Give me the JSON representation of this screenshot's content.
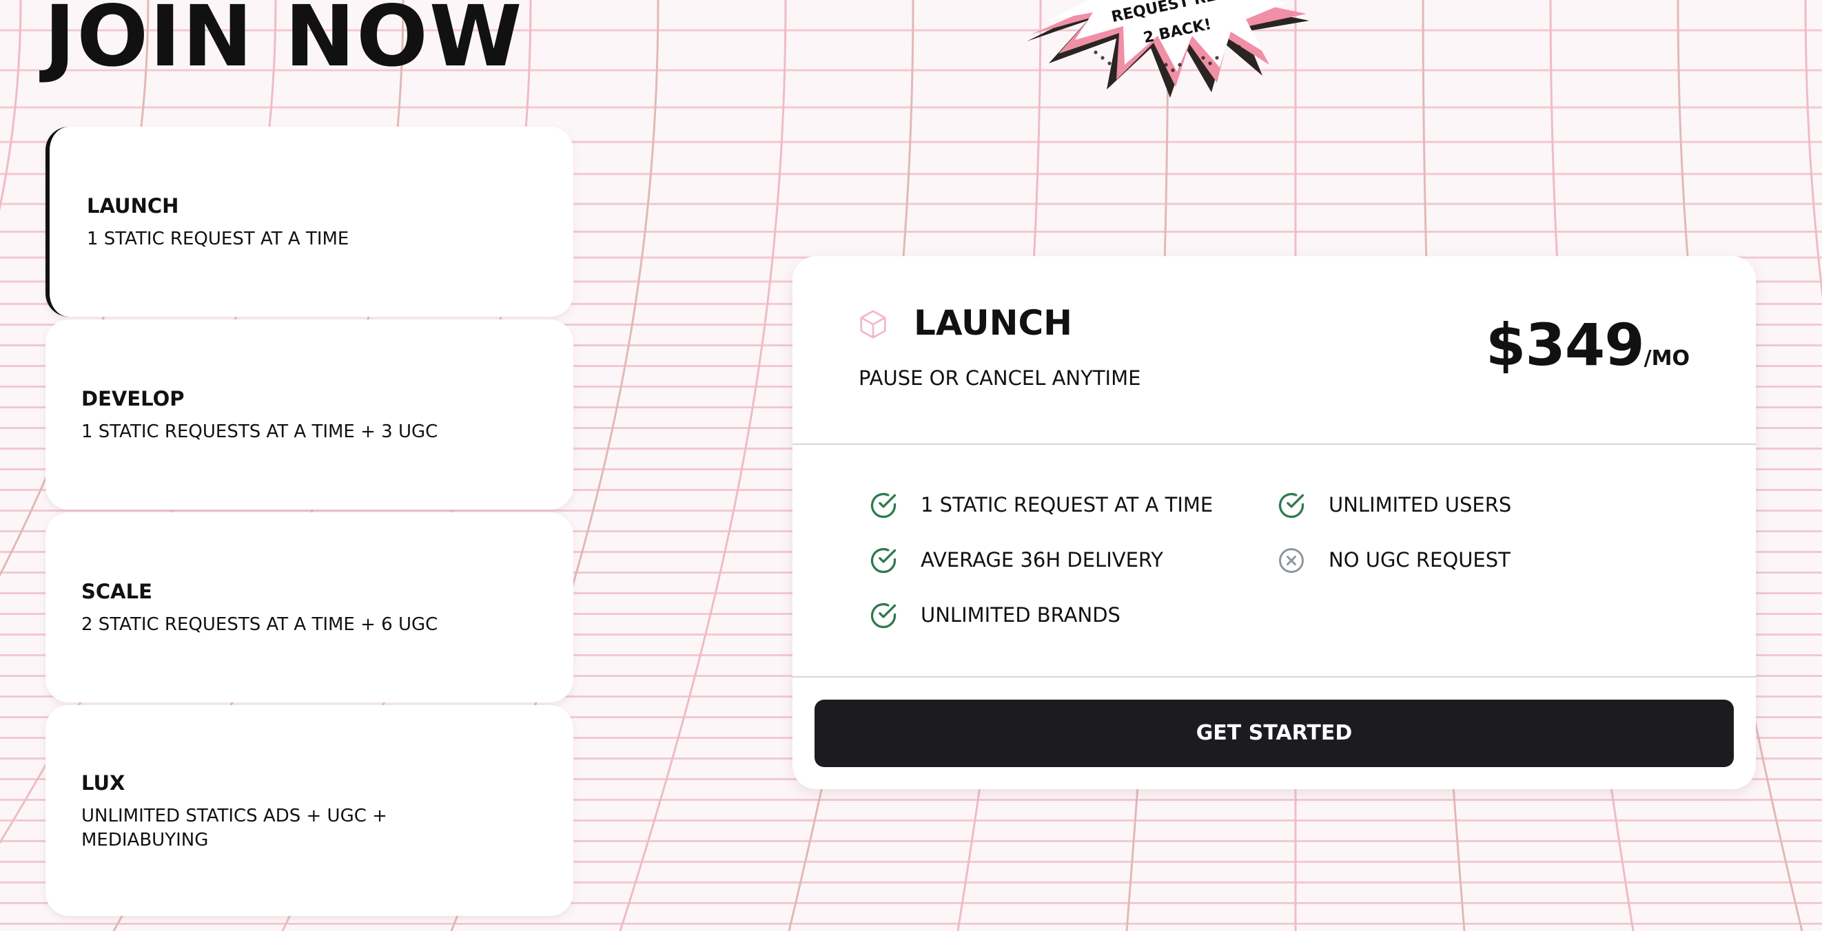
{
  "page": {
    "title": "JOIN NOW"
  },
  "badge": {
    "line1": "REQUEST RE",
    "line2": "2 BACK!"
  },
  "plans": [
    {
      "name": "LAUNCH",
      "description": "1 STATIC REQUEST AT A TIME",
      "active": true
    },
    {
      "name": "DEVELOP",
      "description": "1 STATIC REQUESTS AT A TIME + 3 UGC",
      "active": false
    },
    {
      "name": "SCALE",
      "description": "2 STATIC REQUESTS AT A TIME + 6 UGC",
      "active": false
    },
    {
      "name": "LUX",
      "description": "UNLIMITED STATICS ADS + UGC + MEDIABUYING",
      "active": false
    }
  ],
  "detail": {
    "icon": "cube-icon",
    "title": "LAUNCH",
    "subtitle": "PAUSE OR CANCEL ANYTIME",
    "price": "$349",
    "period": "/MO",
    "features": [
      {
        "label": "1 STATIC REQUEST AT A TIME",
        "included": true,
        "icon": "check-circle-icon"
      },
      {
        "label": "UNLIMITED USERS",
        "included": true,
        "icon": "check-circle-icon"
      },
      {
        "label": "AVERAGE 36H DELIVERY",
        "included": true,
        "icon": "check-circle-icon"
      },
      {
        "label": "NO UGC REQUEST",
        "included": false,
        "icon": "x-circle-icon"
      },
      {
        "label": "UNLIMITED BRANDS",
        "included": true,
        "icon": "check-circle-icon"
      }
    ],
    "cta": "GET STARTED"
  },
  "colors": {
    "background": "#fcf6f8",
    "grid_line": "#f2c9cf",
    "check_green": "#2f7a4e",
    "cross_gray": "#8d949e",
    "button_dark": "#1c1c20",
    "burst_pink": "#f08fa6",
    "burst_dark": "#2a2522"
  }
}
